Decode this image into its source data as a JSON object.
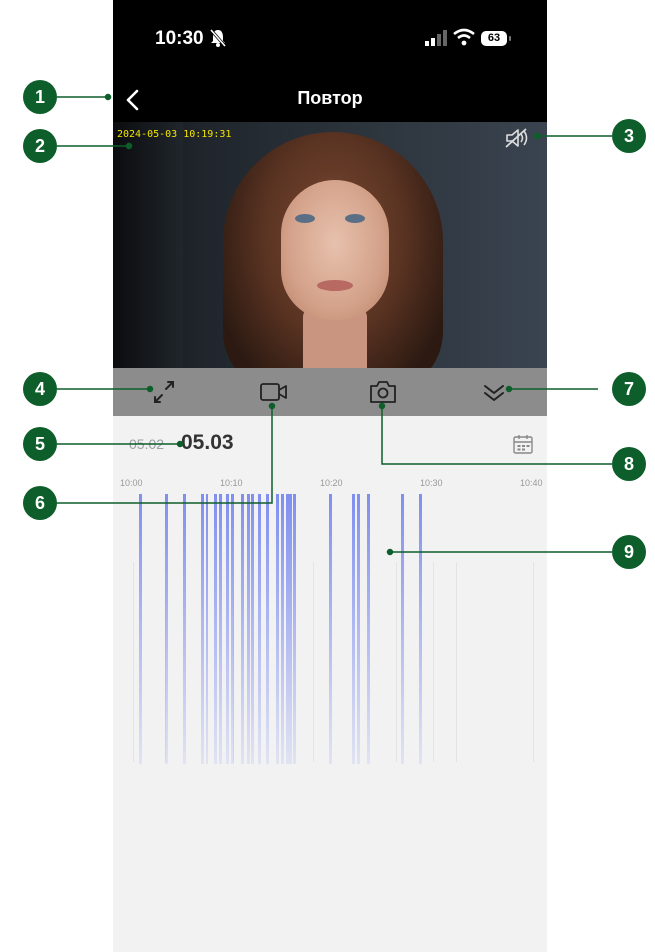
{
  "status_bar": {
    "time": "10:30",
    "battery": "63"
  },
  "nav": {
    "title": "Повтор",
    "back_icon": "chevron-left-icon"
  },
  "video": {
    "timestamp": "2024-05-03 10:19:31",
    "mute_icon": "speaker-muted-icon"
  },
  "controls": [
    {
      "name": "fullscreen",
      "icon": "expand-arrows-icon"
    },
    {
      "name": "record",
      "icon": "video-camera-icon"
    },
    {
      "name": "snapshot",
      "icon": "camera-icon"
    },
    {
      "name": "collapse",
      "icon": "double-chevron-down-icon"
    }
  ],
  "date_bar": {
    "previous_date": "05.02",
    "current_date": "05.03",
    "calendar_icon": "calendar-icon"
  },
  "timeline": {
    "tick_labels": [
      "10:00",
      "10:10",
      "10:20",
      "10:30",
      "10:40"
    ],
    "recording_color": "#7f8ff0"
  },
  "callouts": [
    "1",
    "2",
    "3",
    "4",
    "5",
    "6",
    "7",
    "8",
    "9"
  ],
  "colors": {
    "callout": "#0d5e2a",
    "timestamp": "#f3e600",
    "controls_bar": "#8c8c8c"
  }
}
